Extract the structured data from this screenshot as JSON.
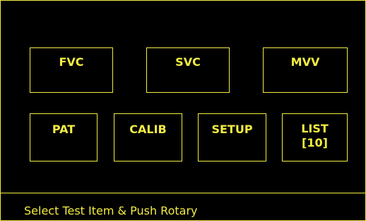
{
  "theme": {
    "background": "#000000",
    "foreground": "#F2EC43"
  },
  "menu": {
    "fvc": "FVC",
    "svc": "SVC",
    "mvv": "MVV",
    "pat": "PAT",
    "calib": "CALIB",
    "setup": "SETUP",
    "list": "LIST\n[10]"
  },
  "status": {
    "message": "Select Test Item & Push Rotary"
  }
}
